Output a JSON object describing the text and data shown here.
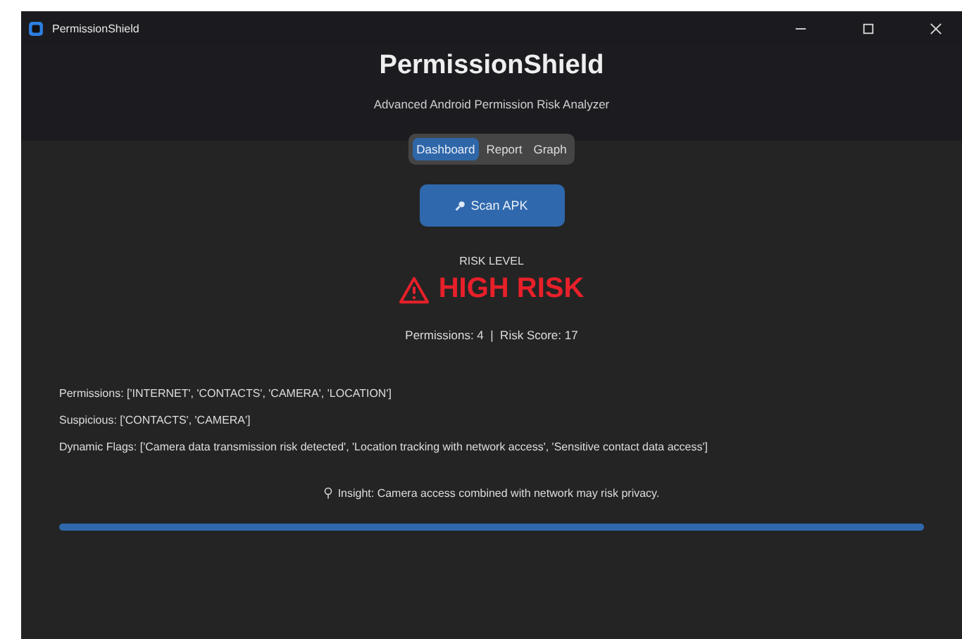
{
  "window": {
    "title": "PermissionShield"
  },
  "header": {
    "title": "PermissionShield",
    "subtitle": "Advanced Android Permission Risk Analyzer"
  },
  "tabs": [
    {
      "label": "Dashboard",
      "selected": true
    },
    {
      "label": "Report",
      "selected": false
    },
    {
      "label": "Graph",
      "selected": false
    }
  ],
  "scan_button": {
    "label": "Scan APK"
  },
  "risk": {
    "caption": "RISK LEVEL",
    "level_text": "HIGH RISK",
    "color": "#e8202a",
    "summary": "Permissions: 4  |  Risk Score: 17"
  },
  "details": [
    "Permissions: ['INTERNET', 'CONTACTS', 'CAMERA', 'LOCATION']",
    "Suspicious: ['CONTACTS', 'CAMERA']",
    "Dynamic Flags: ['Camera data transmission risk detected', 'Location tracking with network access', 'Sensitive contact data access']"
  ],
  "insight": "Insight: Camera access combined with network may risk privacy.",
  "progress": {
    "level": 1
  }
}
